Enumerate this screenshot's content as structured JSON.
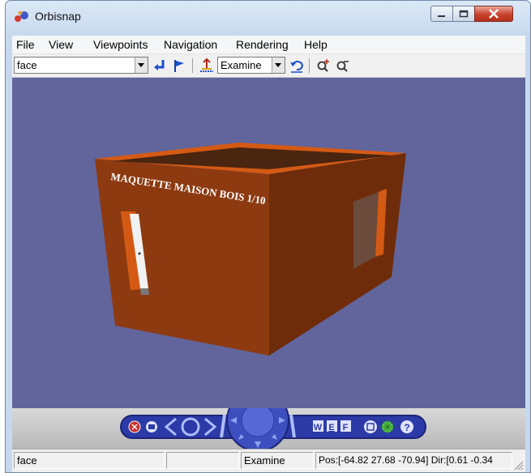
{
  "window": {
    "title": "Orbisnap",
    "icon": "orbisnap-app-icon",
    "controls": [
      "minimize-icon",
      "maximize-icon",
      "close-icon"
    ]
  },
  "menu": [
    "File",
    "View",
    "Viewpoints",
    "Navigation",
    "Rendering",
    "Help"
  ],
  "toolbar": {
    "viewpoint_value": "face",
    "nav_mode_value": "Examine",
    "icons": [
      "go-to-viewpoint-icon",
      "flag-icon",
      "straighten-up-icon",
      "undo-move-icon",
      "zoom-in-icon",
      "zoom-out-icon"
    ]
  },
  "scene": {
    "sign_text": "MAQUETTE MAISON BOIS 1/10",
    "background_color": "#61659b",
    "wall_color": "#8d3a11",
    "trim_color": "#d45a14"
  },
  "navpanel": {
    "icons": [
      "close-circle-icon",
      "restore-icon",
      "previous-viewpoint-icon",
      "viewpoints-ring-icon",
      "next-viewpoint-icon",
      "compass-pad-icon",
      "walk-mode-icon",
      "examine-mode-icon",
      "fly-mode-icon",
      "fit-view-icon",
      "headlight-icon",
      "help-icon"
    ],
    "mode_labels": [
      "W",
      "E",
      "F"
    ]
  },
  "status": {
    "viewpoint": "face",
    "mode": "Examine",
    "position": "Pos:[-64.82 27.68 -70.94] Dir:[0.61 -0.34"
  }
}
